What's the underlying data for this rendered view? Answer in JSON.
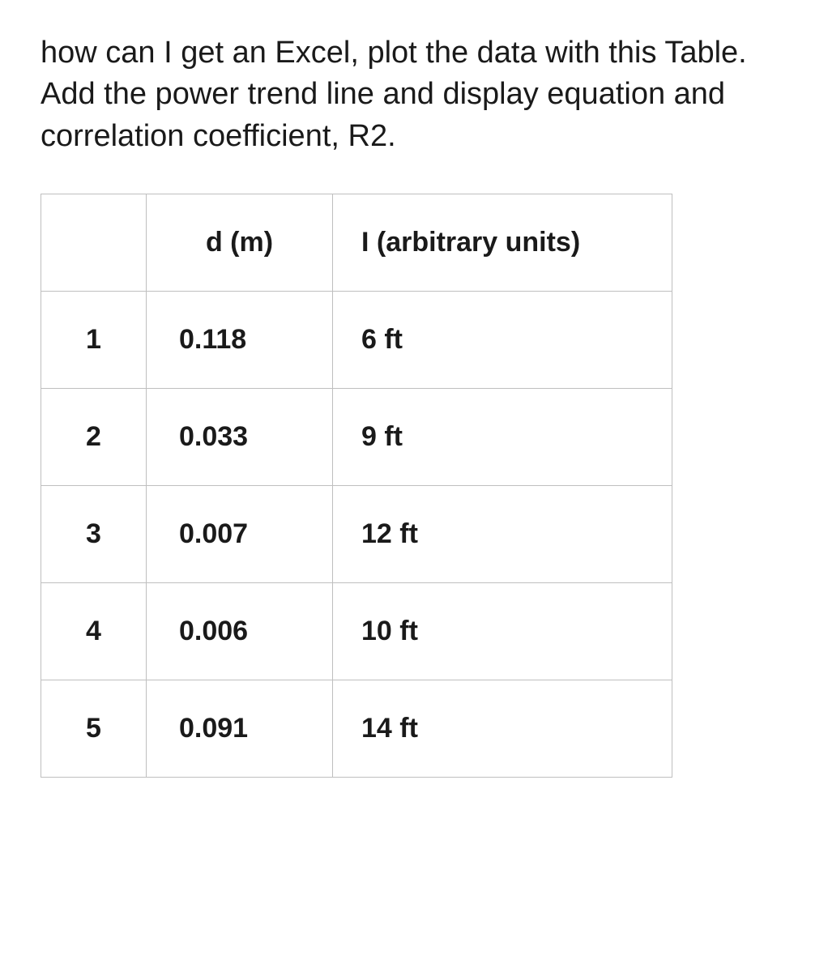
{
  "question": "how can I get an Excel, plot the data with this  Table. Add the power trend line and display equation and correlation coefficient, R2.",
  "table": {
    "headers": {
      "index": "",
      "d": "d (m)",
      "i": "I (arbitrary units)"
    },
    "rows": [
      {
        "index": "1",
        "d": "0.118",
        "i": "6 ft"
      },
      {
        "index": "2",
        "d": "0.033",
        "i": "9 ft"
      },
      {
        "index": "3",
        "d": "0.007",
        "i": "12 ft"
      },
      {
        "index": "4",
        "d": "0.006",
        "i": "10 ft"
      },
      {
        "index": "5",
        "d": "0.091",
        "i": "14 ft"
      }
    ]
  },
  "chart_data": {
    "type": "table",
    "columns": [
      "",
      "d (m)",
      "I (arbitrary units)"
    ],
    "rows": [
      [
        "1",
        "0.118",
        "6 ft"
      ],
      [
        "2",
        "0.033",
        "9 ft"
      ],
      [
        "3",
        "0.007",
        "12 ft"
      ],
      [
        "4",
        "0.006",
        "10 ft"
      ],
      [
        "5",
        "0.091",
        "14 ft"
      ]
    ]
  }
}
